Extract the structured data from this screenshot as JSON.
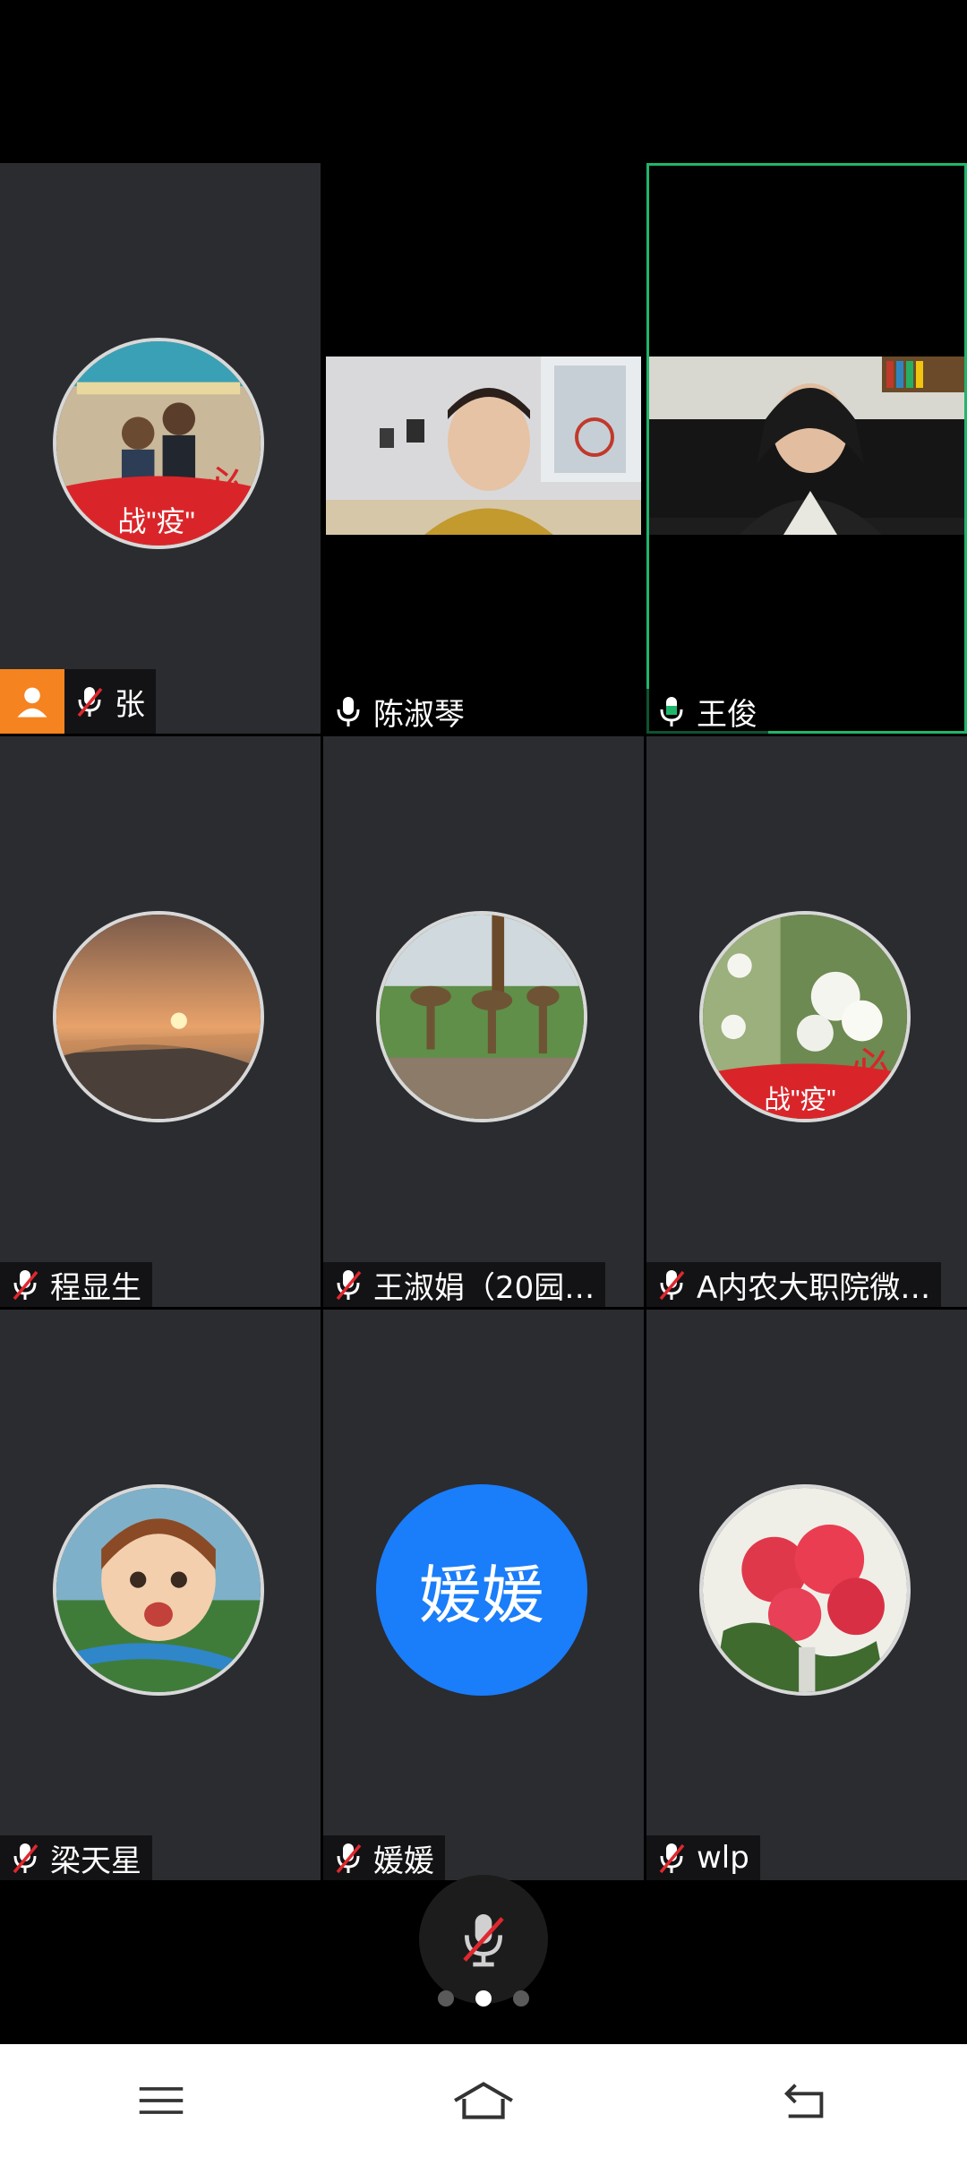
{
  "participants": [
    {
      "name": "张",
      "mic": "muted",
      "kind": "avatar",
      "host": true
    },
    {
      "name": "陈淑琴",
      "mic": "on",
      "kind": "video"
    },
    {
      "name": "王俊",
      "mic": "speaking",
      "kind": "video",
      "active": true
    },
    {
      "name": "程显生",
      "mic": "muted",
      "kind": "avatar"
    },
    {
      "name": "王淑娟（20园…",
      "mic": "muted",
      "kind": "avatar"
    },
    {
      "name": "A内农大职院微…",
      "mic": "muted",
      "kind": "avatar"
    },
    {
      "name": "梁天星",
      "mic": "muted",
      "kind": "avatar"
    },
    {
      "name": "媛媛",
      "mic": "muted",
      "kind": "text-avatar",
      "avatar_text": "媛媛",
      "avatar_color": "#1a7dfa"
    },
    {
      "name": "wlp",
      "mic": "muted",
      "kind": "avatar"
    }
  ],
  "controls": {
    "self_mic": "muted"
  },
  "pager": {
    "pages": 3,
    "current": 2
  },
  "nav": {
    "items": [
      "menu-icon",
      "home-icon",
      "back-icon"
    ]
  },
  "colors": {
    "active_border": "#21b56b",
    "host_badge": "#f5831f",
    "mute_slash": "#e0282e",
    "speaking": "#21b56b"
  }
}
